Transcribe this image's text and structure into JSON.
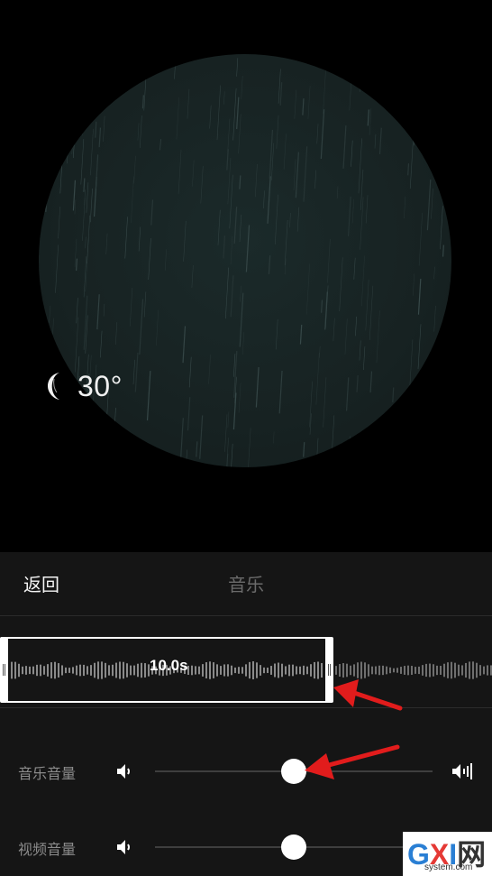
{
  "preview": {
    "temperature": "30°",
    "weather_icon": "moon-icon"
  },
  "topbar": {
    "back_label": "返回",
    "title": "音乐"
  },
  "clip": {
    "duration": "10.0s"
  },
  "sliders": {
    "music_volume": {
      "label": "音乐音量",
      "value": 0.5
    },
    "video_volume": {
      "label": "视频音量",
      "value": 0.5
    }
  },
  "colors": {
    "panel_bg": "#151515",
    "annotation_arrow": "#e11c1c",
    "thumb": "#ffffff"
  },
  "watermark": {
    "logo_text": "GXI网",
    "url": "system.com"
  }
}
